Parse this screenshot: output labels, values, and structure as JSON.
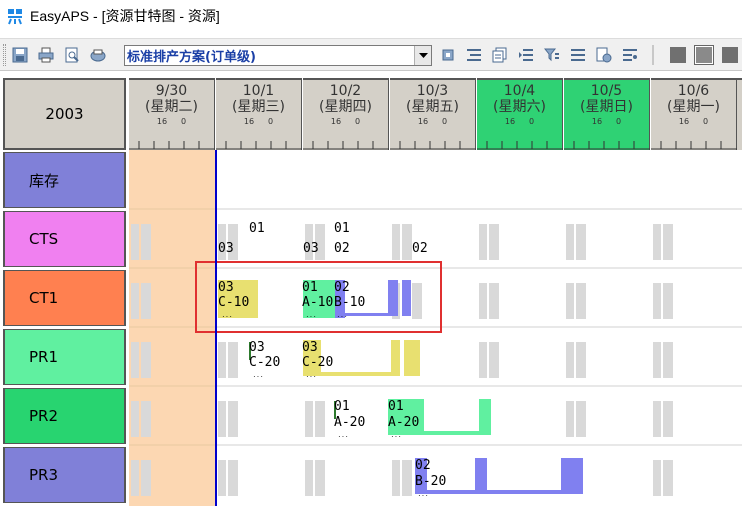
{
  "window": {
    "title": "EasyAPS - [资源甘特图 - 资源]",
    "icon": "easyaps-logo-icon"
  },
  "toolbar": {
    "plan_select": {
      "value": "标准排产方案(订单级)"
    },
    "icons": [
      "save-icon",
      "print-icon",
      "print-preview-icon",
      "printer-setup-icon",
      "refresh-icon",
      "align-icon",
      "copy-icon",
      "indent-icon",
      "filter-icon",
      "list-icon",
      "export-icon",
      "properties-icon",
      "gray-square-icon",
      "gray-square-icon",
      "gray-square-icon"
    ]
  },
  "gantt": {
    "year": "2003",
    "days": [
      {
        "date": "9/30",
        "weekday": "(星期二)",
        "h1": "16",
        "h2": "0",
        "highlight": false
      },
      {
        "date": "10/1",
        "weekday": "(星期三)",
        "h1": "16",
        "h2": "0",
        "highlight": false
      },
      {
        "date": "10/2",
        "weekday": "(星期四)",
        "h1": "16",
        "h2": "0",
        "highlight": false
      },
      {
        "date": "10/3",
        "weekday": "(星期五)",
        "h1": "16",
        "h2": "0",
        "highlight": false
      },
      {
        "date": "10/4",
        "weekday": "(星期六)",
        "h1": "16",
        "h2": "0",
        "highlight": true
      },
      {
        "date": "10/5",
        "weekday": "(星期日)",
        "h1": "16",
        "h2": "0",
        "highlight": true
      },
      {
        "date": "10/6",
        "weekday": "(星期一)",
        "h1": "16",
        "h2": "0",
        "highlight": false
      }
    ],
    "resources": [
      {
        "name": "库存",
        "color": "#8080d8"
      },
      {
        "name": "CTS",
        "color": "#f080f0"
      },
      {
        "name": "CT1",
        "color": "#ff8050"
      },
      {
        "name": "PR1",
        "color": "#60f0a0"
      },
      {
        "name": "PR2",
        "color": "#28d470"
      },
      {
        "name": "PR3",
        "color": "#8080d8"
      }
    ],
    "labels": {
      "cts_01a": "01",
      "cts_03a": "03",
      "cts_01b": "01",
      "cts_03b": "03",
      "cts_02b": "02",
      "cts_02c": "02",
      "ct1_a_l1": "03",
      "ct1_a_l2": "C-10",
      "ct1_b_l1": "01",
      "ct1_b_l2": "A-10",
      "ct1_c_l1": "02",
      "ct1_c_l2": "B-10",
      "pr1_a_l1": "03",
      "pr1_a_l2": "C-20",
      "pr1_b_l1": "03",
      "pr1_b_l2": "C-20",
      "pr2_a_l1": "01",
      "pr2_a_l2": "A-20",
      "pr2_b_l1": "01",
      "pr2_b_l2": "A-20",
      "pr3_a_l1": "02",
      "pr3_a_l2": "B-20"
    },
    "colors": {
      "weekend": "#2fd274",
      "before_today": "#fcd7b2",
      "today_line": "#0000cc",
      "yellow": "#e8e070",
      "mint": "#60f0a0",
      "green": "#30e080",
      "blue": "#8080f0",
      "highlight_box": "#e03030"
    }
  }
}
